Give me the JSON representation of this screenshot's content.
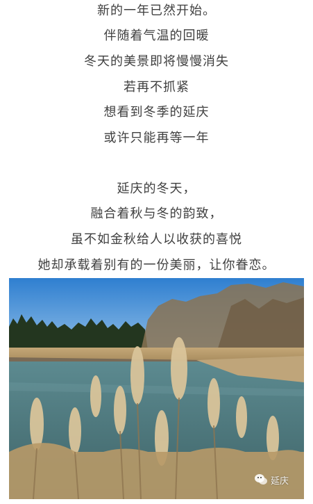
{
  "article": {
    "stanza1": [
      "新的一年已然开始。",
      "伴随着气温的回暖",
      "冬天的美景即将慢慢消失",
      "若再不抓紧",
      "想看到冬季的延庆",
      "或许只能再等一年"
    ],
    "stanza2": [
      "延庆的冬天，",
      "融合着秋与冬的韵致，",
      "虽不如金秋给人以收获的喜悦",
      "她却承载着别有的一份美丽，让你眷恋。"
    ]
  },
  "photo": {
    "watermark_text": "延庆",
    "watermark_icon": "wechat-icon"
  }
}
